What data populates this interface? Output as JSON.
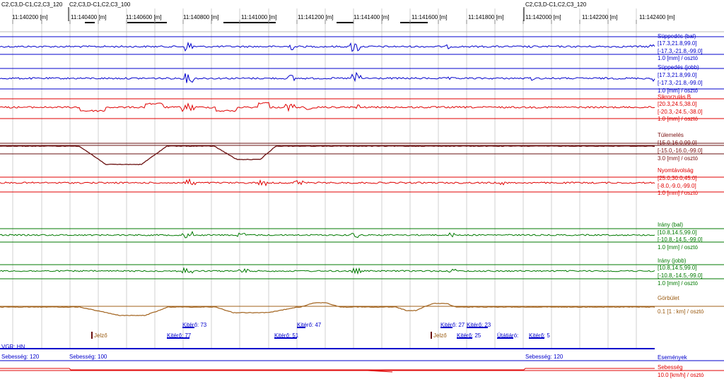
{
  "header": {
    "sections": [
      "C2,C3,D-C1,C2,C3_120",
      "C2,C3,D-C1,C2,C3_100",
      "C2,C3,D-C1,C2,C3_120"
    ],
    "ticks": [
      "11:140200 [m]",
      "11:140400 [m]",
      "11:140600 [m]",
      "11:140800 [m]",
      "11:141000 [m]",
      "11:141200 [m]",
      "11:141400 [m]",
      "11:141600 [m]",
      "11:141800 [m]",
      "11:142000 [m]",
      "11:142200 [m]",
      "11:142400 [m]"
    ]
  },
  "colors": {
    "blue": "#0000cc",
    "red": "#e00000",
    "dark_red": "#6a1010",
    "green": "#007a00",
    "brown": "#a0601a",
    "grid": "#d0d0d0"
  },
  "chart_data": {
    "type": "line",
    "x_unit": "m",
    "x_range": [
      140100,
      142450
    ],
    "channels": [
      {
        "name": "Süppedés (bal)",
        "range_pos": "[17.3,21.8,99.0]",
        "range_neg": "[-17.3,-21.8,-99.0]",
        "scale": "1.0 [mm] / osztó",
        "color": "blue"
      },
      {
        "name": "Süppedés (jobb)",
        "range_pos": "[17.3,21.8,99.0]",
        "range_neg": "[-17.3,-21.8,-99.0]",
        "scale": "1.0 [mm] / osztó",
        "color": "blue"
      },
      {
        "name": "Sikrorzulás B",
        "range_pos": "[20.3,24.5,38.0]",
        "range_neg": "[-20.3,-24.5,-38.0]",
        "scale": "1.0 [mm] / osztó",
        "color": "red"
      },
      {
        "name": "Túlemelés",
        "range_pos": "[15.0,16.0,99.0]",
        "range_neg": "[-15.0,-16.0,-99.0]",
        "scale": "3.0 [mm] / osztó",
        "color": "dark_red"
      },
      {
        "name": "Nyomtávolság",
        "range_pos": "[25.0,30.0,45.0]",
        "range_neg": "[-8.0,-9.0,-99.0]",
        "scale": "1.0 [mm] / osztó",
        "color": "red"
      },
      {
        "name": "Irány (bal)",
        "range_pos": "[10.8,14.5,99.0]",
        "range_neg": "[-10.8,-14.5,-99.0]",
        "scale": "1.0 [mm] / osztó",
        "color": "green"
      },
      {
        "name": "Irány (jobb)",
        "range_pos": "[10.8,14.5,99.0]",
        "range_neg": "[-10.8,-14.5,-99.0]",
        "scale": "1.0 [mm] / osztó",
        "color": "green"
      },
      {
        "name": "Görbület",
        "scale": "0.1 [1 : km] / osztó",
        "color": "brown"
      }
    ],
    "events": [
      {
        "label": "Kitérő: 73",
        "x_m": 140980
      },
      {
        "label": "Kitérő: 47",
        "x_m": 141350
      },
      {
        "label": "Kitérő: 27",
        "x_m": 141785
      },
      {
        "label": "Kitérő: 23",
        "x_m": 141855
      },
      {
        "label": "Jelző",
        "x_m": 140310
      },
      {
        "label": "Kitérő: 77",
        "x_m": 140860
      },
      {
        "label": "Kitérő: 51",
        "x_m": 141210
      },
      {
        "label": "Jelző",
        "x_m": 141785
      },
      {
        "label": "Kitérő: 25",
        "x_m": 141835
      },
      {
        "label": "Útátjáró:",
        "x_m": 141930
      },
      {
        "label": "Kitérő: 5",
        "x_m": 142050
      }
    ],
    "vgr": "VGR: HN",
    "speeds": [
      "Sebesség: 120",
      "Sebesség: 100",
      "Sebesség: 120"
    ],
    "bottom_labels": {
      "events": "Események",
      "speed": "Sebesség",
      "speed_scale": "10.0 [km/h] / osztó"
    }
  }
}
